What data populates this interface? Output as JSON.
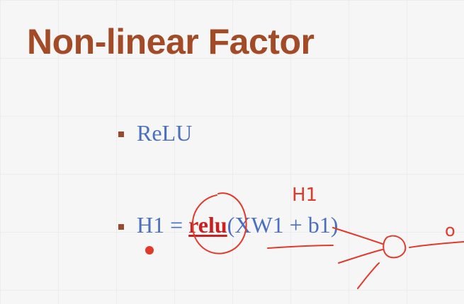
{
  "slide": {
    "title": "Non-linear Factor",
    "items": [
      {
        "text": "ReLU"
      },
      {
        "prefix": "H1 = ",
        "highlight": "relu",
        "suffix": "(XW1 + b1)"
      }
    ]
  },
  "annotations": {
    "label_h1": "H1",
    "label_o": "o"
  },
  "colors": {
    "title": "#a34a26",
    "text": "#4a6fbf",
    "highlight": "#cc1f1f",
    "ink": "#e23a2a",
    "bullet": "#9a4a2c"
  }
}
